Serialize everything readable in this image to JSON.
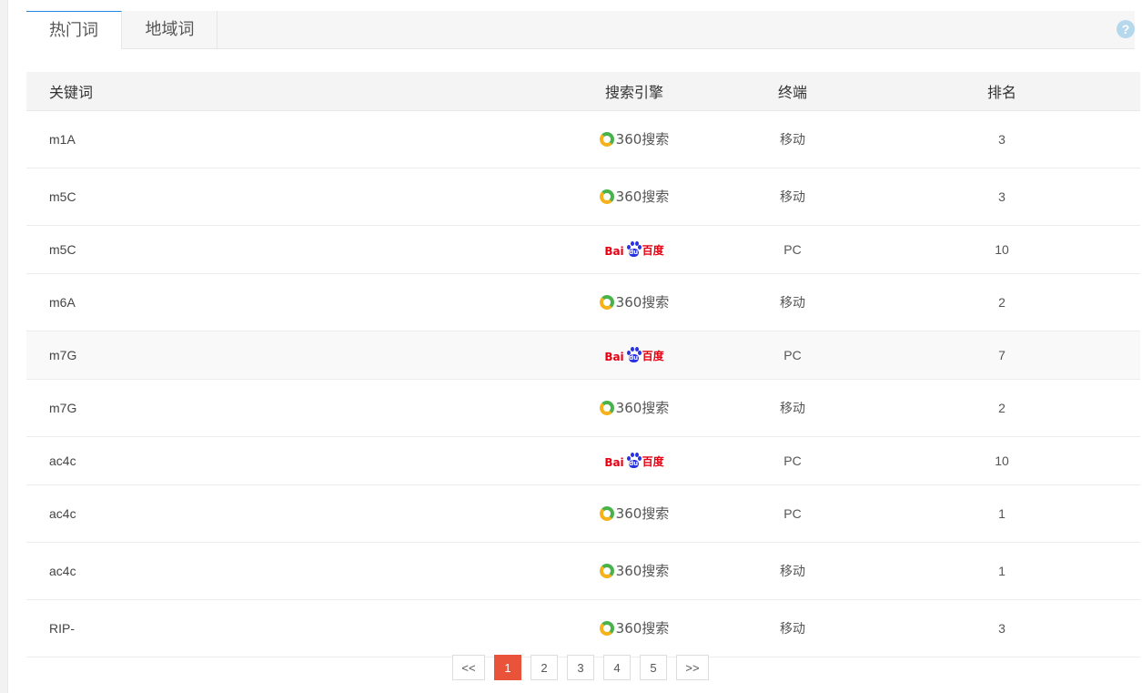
{
  "tabs": [
    {
      "label": "热门词",
      "active": true
    },
    {
      "label": "地域词",
      "active": false
    }
  ],
  "help_label": "?",
  "table": {
    "headers": [
      "关键词",
      "搜索引擎",
      "终端",
      "排名"
    ],
    "rows": [
      {
        "keyword": "m1A",
        "engine": "360",
        "device": "移动",
        "rank": "3"
      },
      {
        "keyword": "m5C",
        "engine": "360",
        "device": "移动",
        "rank": "3"
      },
      {
        "keyword": "m5C",
        "engine": "baidu",
        "device": "PC",
        "rank": "10"
      },
      {
        "keyword": "m6A",
        "engine": "360",
        "device": "移动",
        "rank": "2"
      },
      {
        "keyword": "m7G",
        "engine": "baidu",
        "device": "PC",
        "rank": "7"
      },
      {
        "keyword": "m7G",
        "engine": "360",
        "device": "移动",
        "rank": "2"
      },
      {
        "keyword": "ac4c",
        "engine": "baidu",
        "device": "PC",
        "rank": "10"
      },
      {
        "keyword": "ac4c",
        "engine": "360",
        "device": "PC",
        "rank": "1"
      },
      {
        "keyword": "ac4c",
        "engine": "360",
        "device": "移动",
        "rank": "1"
      },
      {
        "keyword": "RIP-",
        "engine": "360",
        "device": "移动",
        "rank": "3"
      }
    ]
  },
  "engines": {
    "360": {
      "text": "360搜索",
      "icon": "360-search-logo"
    },
    "baidu": {
      "left": "Bai",
      "paw": "du",
      "right": "百度",
      "icon": "baidu-logo"
    }
  },
  "pagination": {
    "prev": "<<",
    "pages": [
      "1",
      "2",
      "3",
      "4",
      "5"
    ],
    "current": "1",
    "next": ">>"
  },
  "colors": {
    "accent_blue": "#1e88e5",
    "pager_active": "#e8533a",
    "logo_360_green": "#49b34b",
    "logo_360_yellow": "#f5b21b",
    "baidu_red": "#e60012",
    "baidu_blue": "#2932e1"
  }
}
